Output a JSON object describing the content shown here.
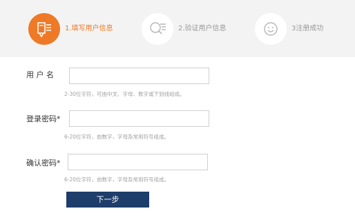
{
  "steps": [
    {
      "label": "1.填写用户信息",
      "icon": "edit-form-icon",
      "active": true
    },
    {
      "label": "2.验证用户信息",
      "icon": "search-list-icon",
      "active": false
    },
    {
      "label": "3注册成功",
      "icon": "smile-icon",
      "active": false
    }
  ],
  "form": {
    "username": {
      "label": "用 户 名",
      "value": "",
      "hint": "2-30位字符，可由中文、字母、数字或下划线组成。"
    },
    "password": {
      "label": "登录密码*",
      "value": "",
      "hint": "6-20位字符，由数字，字母及常用符号组成。"
    },
    "confirm": {
      "label": "确认密码*",
      "value": "",
      "hint": "6-20位字符，由数字，字母及常用符号组成。"
    }
  },
  "next_button": "下一步",
  "colors": {
    "accent": "#ee7a27",
    "step_bar": "#f3f3f3",
    "button": "#1d3d6a"
  }
}
